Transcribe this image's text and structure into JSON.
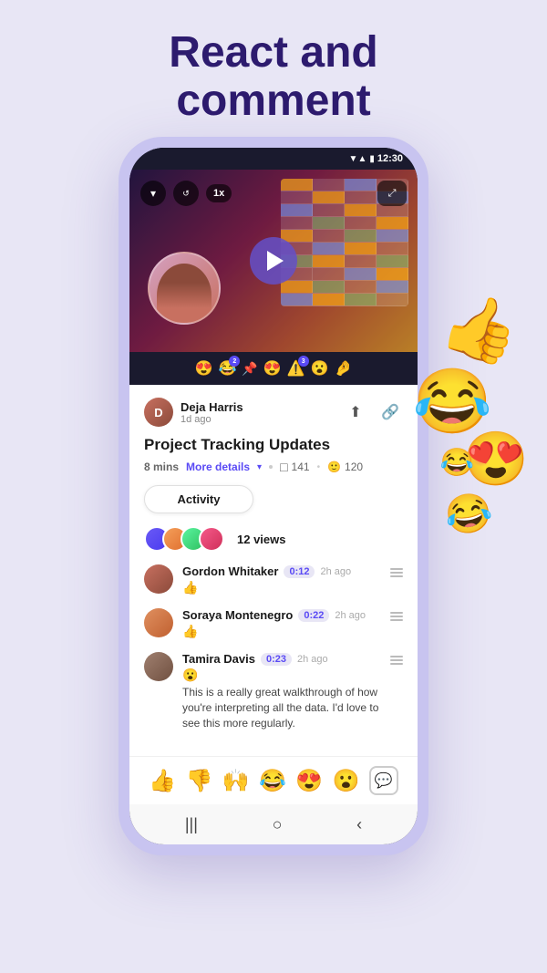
{
  "hero": {
    "title_line1": "React and",
    "title_line2": "comment"
  },
  "status_bar": {
    "time": "12:30",
    "signal": "▼",
    "wifi": "▲",
    "battery": "🔋"
  },
  "video": {
    "speed": "1x",
    "play_label": "Play"
  },
  "emoji_bar": {
    "items": [
      "😍",
      "😂",
      "📌",
      "😍",
      "⚠️",
      "😮",
      "🤌"
    ],
    "badge2": "2",
    "badge3": "3"
  },
  "post": {
    "author": "Deja Harris",
    "time": "1d ago",
    "title": "Project Tracking Updates",
    "duration": "8 mins",
    "more_details": "More details",
    "view_count": "141",
    "emoji_count": "120",
    "activity_tab": "Activity"
  },
  "viewers": {
    "count_text": "12 views"
  },
  "comments": [
    {
      "name": "Gordon Whitaker",
      "timestamp": "0:12",
      "time": "2h ago",
      "reaction": "👍"
    },
    {
      "name": "Soraya Montenegro",
      "timestamp": "0:22",
      "time": "2h ago",
      "reaction": "👍"
    },
    {
      "name": "Tamira Davis",
      "timestamp": "0:23",
      "time": "2h ago",
      "reaction": "😮",
      "text": "This is a really great walkthrough of how you're interpreting all the data. I'd love to see this more regularly."
    }
  ],
  "bottom_emojis": [
    "👍",
    "👎",
    "🙌",
    "😂",
    "😍",
    "😮"
  ],
  "floating_emojis": {
    "thumbsup": "👍",
    "laugh": "😂",
    "heart_eyes": "😍",
    "laugh2": "😂",
    "laugh3": "😂"
  },
  "colors": {
    "brand_purple": "#5a4af5",
    "dark_purple": "#2d1b6e",
    "bg_lavender": "#e8e6f5"
  }
}
